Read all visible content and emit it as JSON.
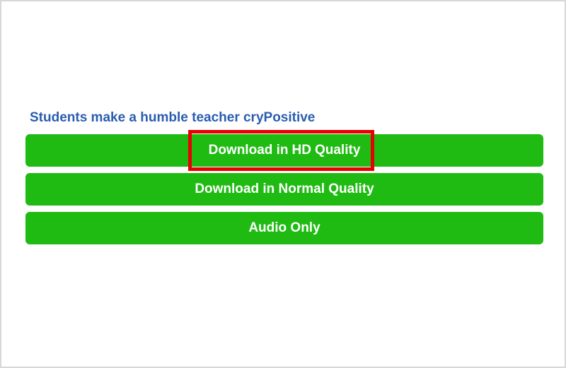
{
  "video": {
    "title": "Students make a humble teacher cryPositive"
  },
  "buttons": {
    "hd": {
      "prefix": "Download in",
      "bold": "HD",
      "suffix": "Quality"
    },
    "normal": {
      "label": "Download in Normal Quality"
    },
    "audio": {
      "label": "Audio Only"
    }
  }
}
